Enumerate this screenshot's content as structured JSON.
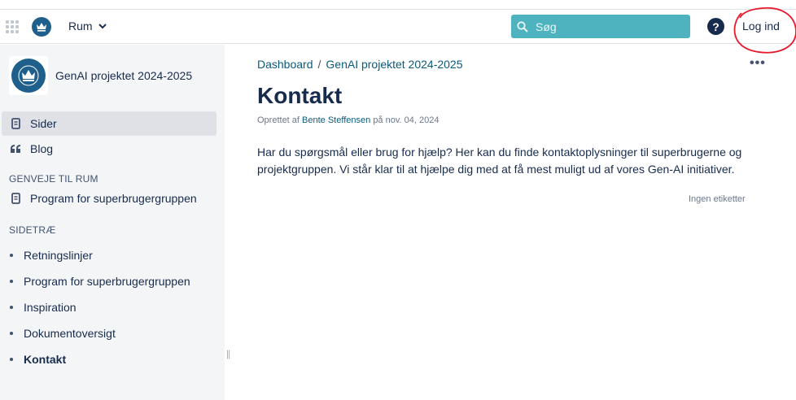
{
  "header": {
    "space_menu_label": "Rum",
    "search_placeholder": "Søg",
    "help_label": "?",
    "login_label": "Log ind"
  },
  "sidebar": {
    "space_title": "GenAI projektet 2024-2025",
    "nav": [
      {
        "label": "Sider",
        "icon": "page-icon"
      },
      {
        "label": "Blog",
        "icon": "quote-icon"
      }
    ],
    "shortcuts_heading": "GENVEJE TIL RUM",
    "shortcuts": [
      {
        "label": "Program for superbrugergruppen",
        "icon": "page-icon"
      }
    ],
    "tree_heading": "SIDETRÆ",
    "tree": [
      {
        "label": "Retningslinjer"
      },
      {
        "label": "Program for superbrugergruppen"
      },
      {
        "label": "Inspiration"
      },
      {
        "label": "Dokumentoversigt"
      },
      {
        "label": "Kontakt"
      }
    ]
  },
  "main": {
    "breadcrumb": [
      "Dashboard",
      "GenAI projektet 2024-2025"
    ],
    "breadcrumb_separator": "/",
    "more_label": "•••",
    "title": "Kontakt",
    "byline_prefix": "Oprettet af",
    "author": "Bente Steffensen",
    "byline_date": "på nov. 04, 2024",
    "body": "Har du spørgsmål eller brug for hjælp? Her kan du finde kontaktoplysninger til superbrugerne og projektgruppen. Vi står klar til at hjælpe dig med at få mest muligt ud af vores Gen-AI initiativer.",
    "labels": "Ingen etiketter"
  },
  "colors": {
    "accent": "#4fb3bf",
    "link": "#0b5a7c",
    "sidebar_bg": "#f4f5f7",
    "annotation": "#e8192c"
  }
}
